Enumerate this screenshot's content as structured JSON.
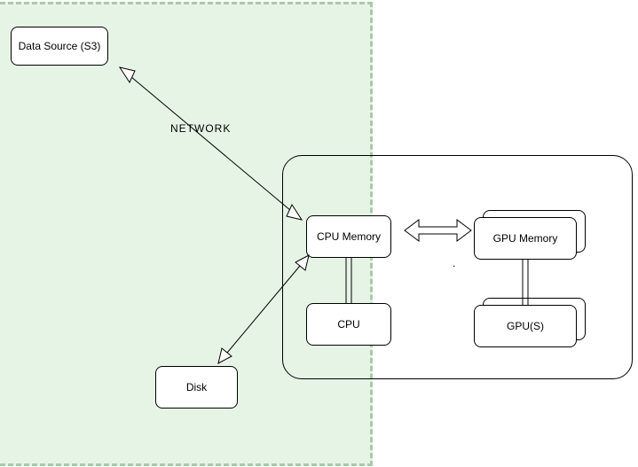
{
  "nodes": {
    "data_source": "Data Source (S3)",
    "cpu_memory": "CPU Memory",
    "cpu": "CPU",
    "gpu_memory": "GPU Memory",
    "gpus": "GPU(S)",
    "disk": "Disk"
  },
  "edges": {
    "network_label": "NETWORK"
  },
  "decor": {
    "dot": "."
  }
}
